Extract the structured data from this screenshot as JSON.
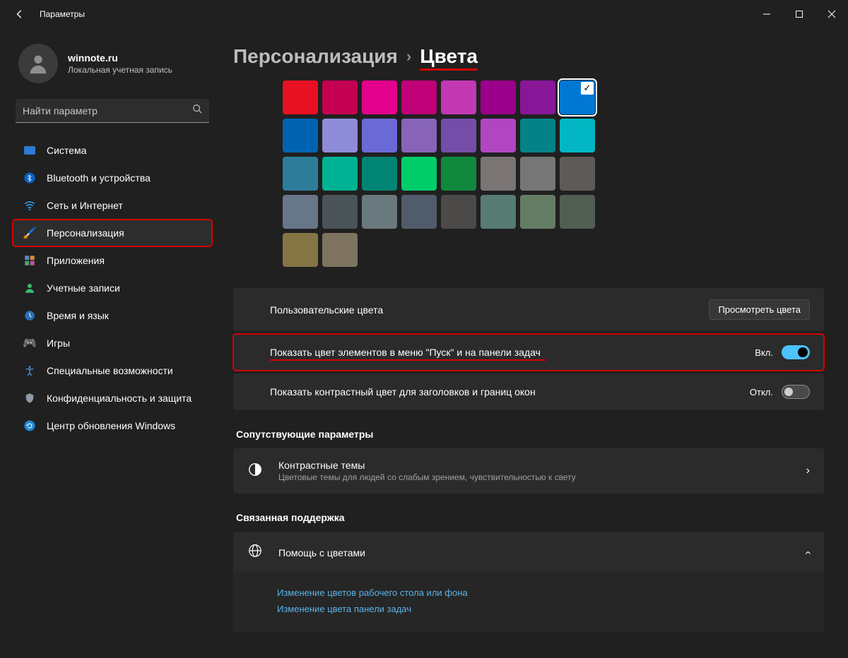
{
  "window": {
    "title": "Параметры"
  },
  "account": {
    "name": "winnote.ru",
    "type": "Локальная учетная запись"
  },
  "search": {
    "placeholder": "Найти параметр"
  },
  "nav": [
    {
      "label": "Система",
      "icon": "🖥️",
      "color": "#3aa0ff"
    },
    {
      "label": "Bluetooth и устройства",
      "icon": "bt"
    },
    {
      "label": "Сеть и Интернет",
      "icon": "wifi"
    },
    {
      "label": "Персонализация",
      "icon": "🖌️",
      "active": true,
      "highlight": true
    },
    {
      "label": "Приложения",
      "icon": "apps"
    },
    {
      "label": "Учетные записи",
      "icon": "user"
    },
    {
      "label": "Время и язык",
      "icon": "clock"
    },
    {
      "label": "Игры",
      "icon": "🎮"
    },
    {
      "label": "Специальные возможности",
      "icon": "access"
    },
    {
      "label": "Конфиденциальность и защита",
      "icon": "shield"
    },
    {
      "label": "Центр обновления Windows",
      "icon": "update"
    }
  ],
  "breadcrumb": {
    "parent": "Персонализация",
    "current": "Цвета"
  },
  "palette": {
    "selected_index": 7,
    "colors": [
      "#e81123",
      "#c30052",
      "#e3008c",
      "#bf0077",
      "#c239b3",
      "#9a0089",
      "#881798",
      "#0078d4",
      "#0063b1",
      "#8e8cd8",
      "#6b69d6",
      "#8764b8",
      "#744da9",
      "#b146c2",
      "#038387",
      "#00b7c3",
      "#2d7d9a",
      "#00b294",
      "#018574",
      "#00cc6a",
      "#10893e",
      "#7a7574",
      "#767676",
      "#5d5a58",
      "#68768a",
      "#4a5459",
      "#69797e",
      "#515c6b",
      "#4c4a48",
      "#567c73",
      "#647c64",
      "#525e54",
      "#847545",
      "#7e735f"
    ]
  },
  "rows": {
    "custom_colors": {
      "label": "Пользовательские цвета",
      "button": "Просмотреть цвета"
    },
    "start_taskbar": {
      "label": "Показать цвет элементов в меню \"Пуск\" и на панели задач",
      "state_label": "Вкл.",
      "on": true,
      "highlight": true
    },
    "title_borders": {
      "label": "Показать контрастный цвет для заголовков и границ окон",
      "state_label": "Откл.",
      "on": false
    }
  },
  "related": {
    "heading": "Сопутствующие параметры",
    "contrast": {
      "title": "Контрастные темы",
      "subtitle": "Цветовые темы для людей со слабым зрением, чувствительностью к свету"
    }
  },
  "support": {
    "heading": "Связанная поддержка",
    "help_title": "Помощь с цветами",
    "links": [
      "Изменение цветов рабочего стола или фона",
      "Изменение цвета панели задач"
    ]
  }
}
